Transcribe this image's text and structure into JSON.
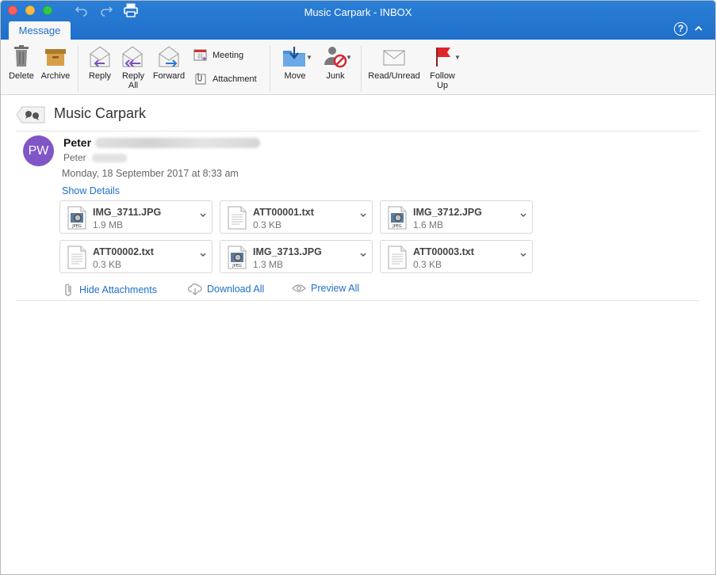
{
  "window": {
    "title": "Music Carpark - INBOX",
    "tab": "Message"
  },
  "ribbon": {
    "delete": "Delete",
    "archive": "Archive",
    "reply": "Reply",
    "reply_all_line1": "Reply",
    "reply_all_line2": "All",
    "forward": "Forward",
    "meeting": "Meeting",
    "attachment": "Attachment",
    "move": "Move",
    "junk": "Junk",
    "read_unread": "Read/Unread",
    "follow_up_line1": "Follow",
    "follow_up_line2": "Up"
  },
  "message": {
    "subject": "Music Carpark",
    "avatar_initials": "PW",
    "sender_name": "Peter",
    "to_name": "Peter",
    "date": "Monday, 18 September 2017 at 8:33 am",
    "show_details": "Show Details"
  },
  "attachments": [
    {
      "name": "IMG_3711.JPG",
      "size": "1.9 MB",
      "type": "jpeg"
    },
    {
      "name": "ATT00001.txt",
      "size": "0.3 KB",
      "type": "txt"
    },
    {
      "name": "IMG_3712.JPG",
      "size": "1.6 MB",
      "type": "jpeg"
    },
    {
      "name": "ATT00002.txt",
      "size": "0.3 KB",
      "type": "txt"
    },
    {
      "name": "IMG_3713.JPG",
      "size": "1.3 MB",
      "type": "jpeg"
    },
    {
      "name": "ATT00003.txt",
      "size": "0.3 KB",
      "type": "txt"
    }
  ],
  "attachment_actions": {
    "hide": "Hide Attachments",
    "download_all": "Download All",
    "preview_all": "Preview All"
  },
  "colors": {
    "titlebar": "#1f6fca",
    "accent": "#1f6fca",
    "avatar": "#7f55c7",
    "flag": "#e0242b"
  },
  "icons": {
    "jpeg_label": "JPEG"
  }
}
